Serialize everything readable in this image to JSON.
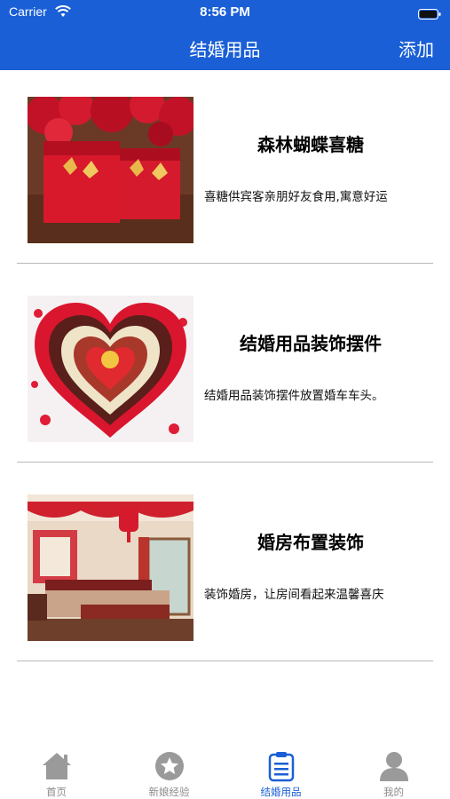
{
  "status_bar": {
    "carrier": "Carrier",
    "time": "8:56 PM"
  },
  "nav": {
    "title": "结婚用品",
    "add_label": "添加"
  },
  "items": [
    {
      "title": "森林蝴蝶喜糖",
      "description": "喜糖供宾客亲朋好友食用,寓意好运",
      "image_icon": "candy-boxes-image"
    },
    {
      "title": "结婚用品装饰摆件",
      "description": "结婚用品装饰摆件放置婚车车头。",
      "image_icon": "heart-decoration-image"
    },
    {
      "title": "婚房布置装饰",
      "description": "装饰婚房，让房间看起来温馨喜庆",
      "image_icon": "wedding-room-image"
    }
  ],
  "tabs": [
    {
      "label": "首页",
      "icon": "home-icon",
      "active": false
    },
    {
      "label": "新娘经验",
      "icon": "star-icon",
      "active": false
    },
    {
      "label": "结婚用品",
      "icon": "clipboard-icon",
      "active": true
    },
    {
      "label": "我的",
      "icon": "person-icon",
      "active": false
    }
  ],
  "colors": {
    "primary": "#1a5fd6",
    "inactive_tab": "#8a8a8a",
    "divider": "#b8b8b8"
  }
}
